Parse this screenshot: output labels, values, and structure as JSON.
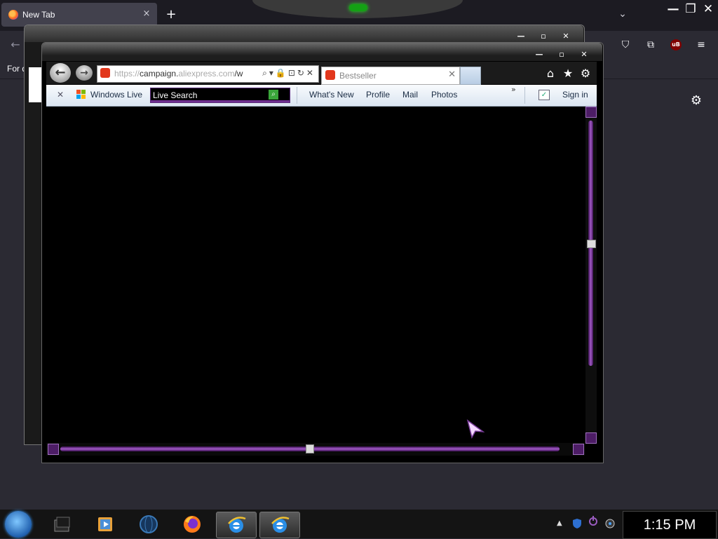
{
  "firefox": {
    "tab_title": "New Tab",
    "tab_close": "×",
    "new_tab": "+",
    "list_tabs": "⌄",
    "back": "←",
    "bookmark_text": "For q",
    "window_buttons": [
      "—",
      "❐",
      "✕"
    ]
  },
  "middle_window": {
    "buttons": [
      "—",
      "▫",
      "✕"
    ]
  },
  "ie": {
    "window_buttons": [
      "—",
      "▫",
      "✕"
    ],
    "back": "←",
    "forward": "→",
    "address": {
      "prefix": "https://",
      "host": "campaign.",
      "dim_host": "aliexpress.com",
      "path": "/w",
      "tools": "⌕▾🔒⊡↻✕"
    },
    "tab": {
      "title": "Bestseller",
      "close": "✕"
    },
    "right_buttons": [
      "⌂",
      "★",
      "⚙"
    ],
    "toolbar": {
      "close": "✕",
      "windows_live": "Windows Live",
      "search_value": "Live Search",
      "links": [
        "What's New",
        "Profile",
        "Mail",
        "Photos"
      ],
      "more": "»",
      "sign_in": "Sign in"
    }
  },
  "taskbar": {
    "apps": [
      "stacked-window-app",
      "media-player",
      "globe-browser",
      "firefox",
      "internet-explorer",
      "internet-explorer"
    ],
    "clock": "1:15 PM"
  },
  "colors": {
    "accent_purple": "#a35cc8",
    "ie_toolbar": "#dbe5f1",
    "firefox_bg": "#2b2a33"
  }
}
